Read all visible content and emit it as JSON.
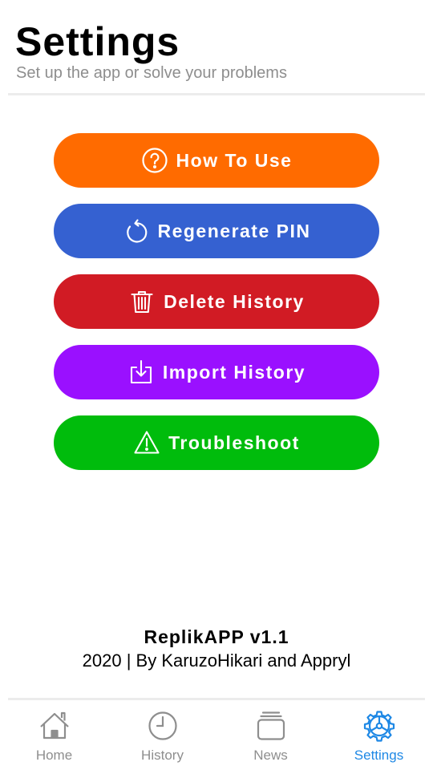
{
  "header": {
    "title": "Settings",
    "subtitle": "Set up the app or solve your problems"
  },
  "actions": [
    {
      "label": "How To Use",
      "icon": "help-circle-icon",
      "color": "#ff6b00"
    },
    {
      "label": "Regenerate PIN",
      "icon": "rotate-ccw-icon",
      "color": "#3561d1"
    },
    {
      "label": "Delete History",
      "icon": "trash-icon",
      "color": "#d11b24"
    },
    {
      "label": "Import History",
      "icon": "download-icon",
      "color": "#9a10ff"
    },
    {
      "label": "Troubleshoot",
      "icon": "warning-icon",
      "color": "#00bc0c"
    }
  ],
  "footer": {
    "app_name": "ReplikAPP v1.1",
    "credit": "2020 | By KaruzoHikari and Appryl"
  },
  "tabbar": {
    "items": [
      {
        "label": "Home",
        "icon": "home-icon",
        "active": false
      },
      {
        "label": "History",
        "icon": "clock-icon",
        "active": false
      },
      {
        "label": "News",
        "icon": "news-icon",
        "active": false
      },
      {
        "label": "Settings",
        "icon": "gear-icon",
        "active": true
      }
    ],
    "active_color": "#1e88e5",
    "inactive_color": "#8e8e8e"
  }
}
